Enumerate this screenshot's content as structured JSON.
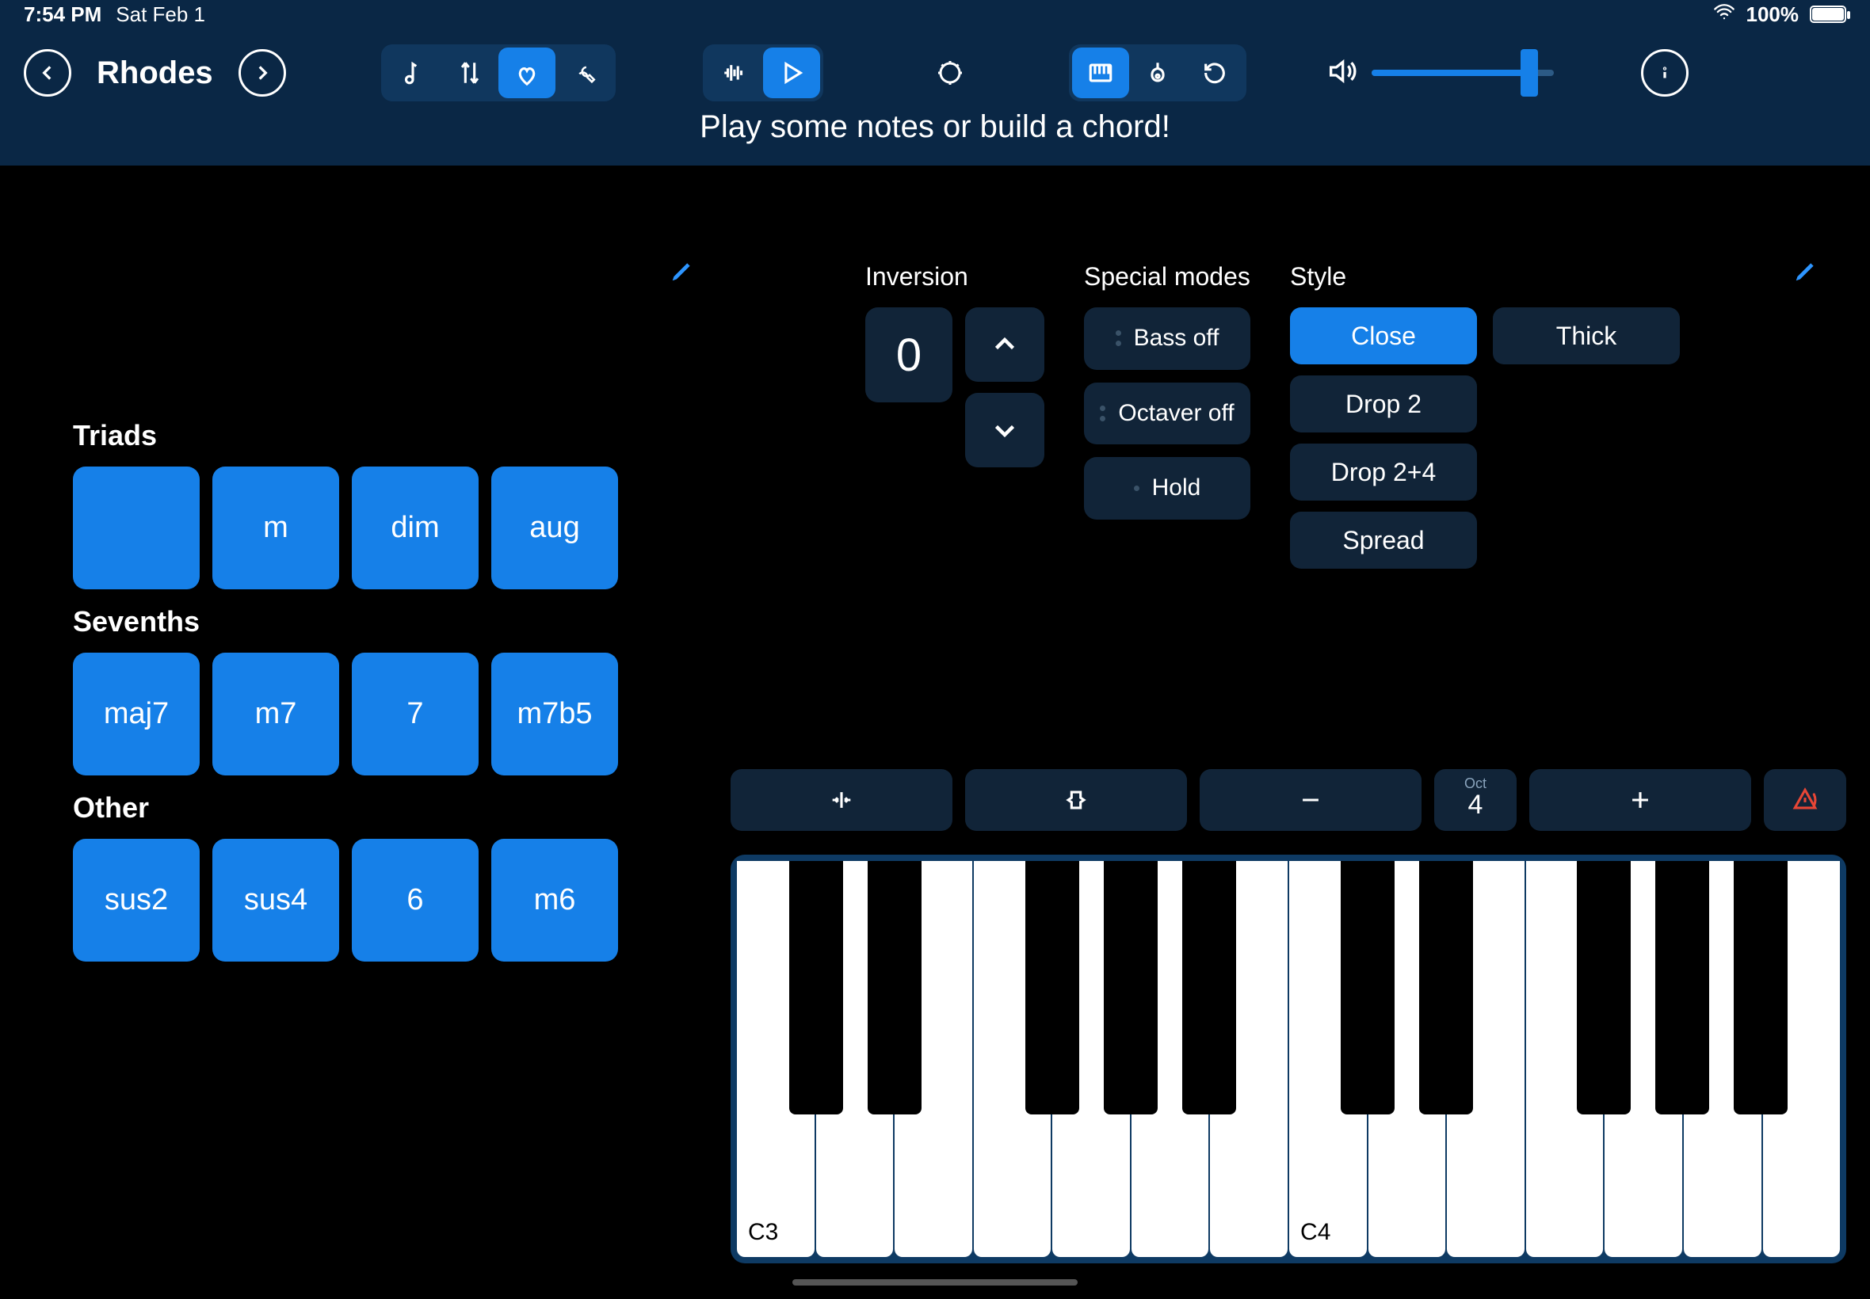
{
  "statusbar": {
    "time": "7:54 PM",
    "date": "Sat Feb 1",
    "battery": "100%"
  },
  "toolbar": {
    "instrument": "Rhodes"
  },
  "banner": "Play some notes or build a chord!",
  "pads": {
    "triads": {
      "title": "Triads",
      "items": [
        "",
        "m",
        "dim",
        "aug"
      ]
    },
    "sevenths": {
      "title": "Sevenths",
      "items": [
        "maj7",
        "m7",
        "7",
        "m7b5"
      ]
    },
    "other": {
      "title": "Other",
      "items": [
        "sus2",
        "sus4",
        "6",
        "m6"
      ]
    }
  },
  "controls": {
    "inversion": {
      "label": "Inversion",
      "value": "0"
    },
    "special": {
      "label": "Special modes",
      "bass": "Bass off",
      "octaver": "Octaver off",
      "hold": "Hold"
    },
    "style": {
      "label": "Style",
      "items": [
        "Close",
        "Thick",
        "Drop 2",
        "Drop 2+4",
        "Spread"
      ],
      "active": "Close"
    }
  },
  "keyboard": {
    "octave_label": "Oct",
    "octave_value": "4",
    "labels": {
      "c3": "C3",
      "c4": "C4"
    }
  }
}
